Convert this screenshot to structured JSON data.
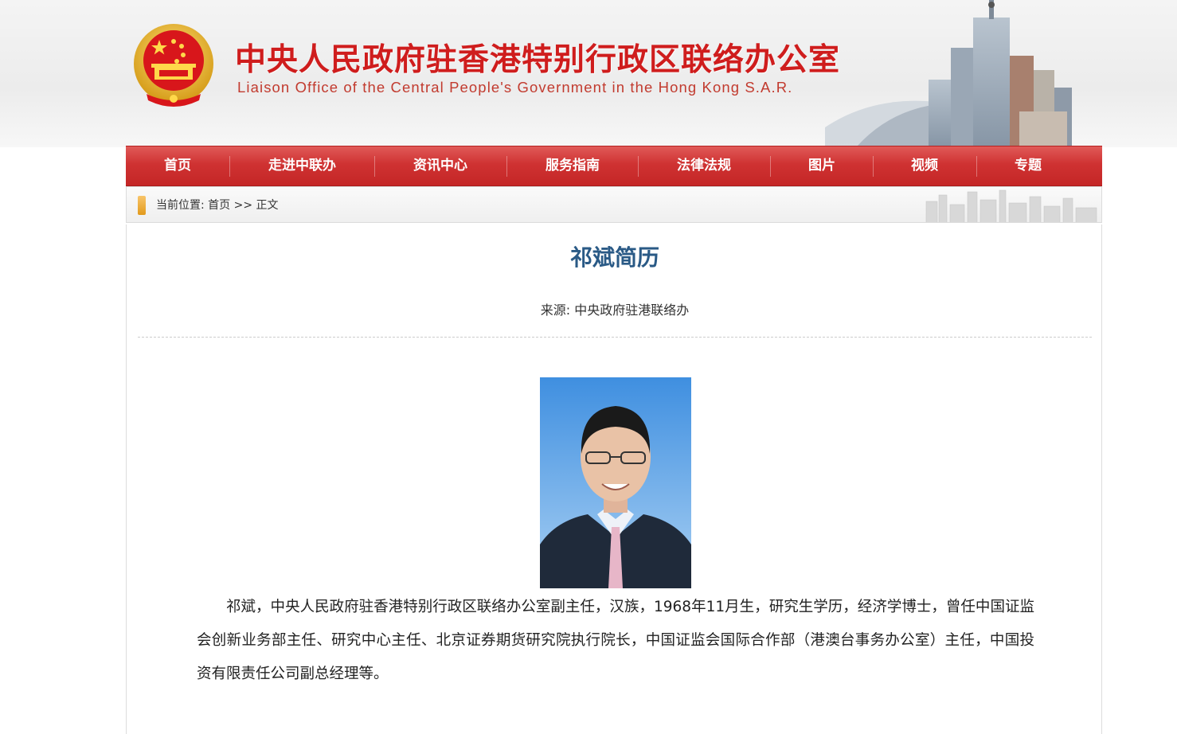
{
  "header": {
    "title_cn": "中央人民政府驻香港特别行政区联络办公室",
    "title_en": "Liaison Office of the Central People's Government in the Hong Kong S.A.R."
  },
  "nav": {
    "items": [
      "首页",
      "走进中联办",
      "资讯中心",
      "服务指南",
      "法律法规",
      "图片",
      "视频",
      "专题"
    ]
  },
  "breadcrumb": {
    "prefix": "当前位置:",
    "home": "首页",
    "sep": ">>",
    "current": "正文"
  },
  "article": {
    "title": "祁斌简历",
    "source": "来源: 中央政府驻港联络办",
    "body": "祁斌，中央人民政府驻香港特别行政区联络办公室副主任，汉族，1968年11月生，研究生学历，经济学博士，曾任中国证监会创新业务部主任、研究中心主任、北京证券期货研究院执行院长，中国证监会国际合作部（港澳台事务办公室）主任，中国投资有限责任公司副总经理等。"
  },
  "colors": {
    "brand_red": "#cf1d1d",
    "nav_red": "#cf3232",
    "title_blue": "#2a5a86"
  }
}
